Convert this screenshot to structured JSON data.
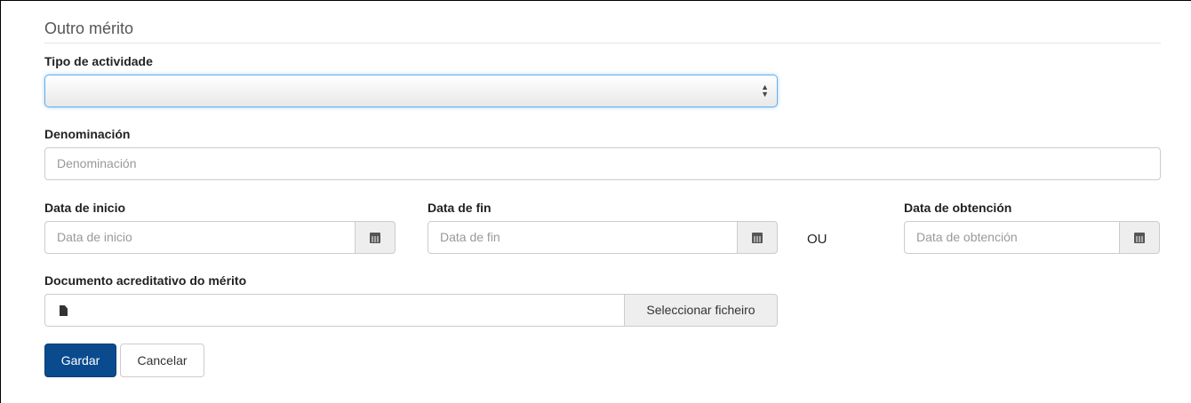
{
  "form": {
    "legend": "Outro mérito",
    "tipo": {
      "label": "Tipo de actividade",
      "value": ""
    },
    "denominacion": {
      "label": "Denominación",
      "placeholder": "Denominación"
    },
    "data_inicio": {
      "label": "Data de inicio",
      "placeholder": "Data de inicio",
      "icon": "calendar-icon"
    },
    "data_fin": {
      "label": "Data de fin",
      "placeholder": "Data de fin",
      "icon": "calendar-icon"
    },
    "ou": "OU",
    "data_obtencion": {
      "label": "Data de obtención",
      "placeholder": "Data de obtención",
      "icon": "calendar-icon"
    },
    "documento": {
      "label": "Documento acreditativo do mérito",
      "button": "Seleccionar ficheiro",
      "icon": "file-icon"
    },
    "actions": {
      "save": "Gardar",
      "cancel": "Cancelar"
    }
  },
  "colors": {
    "primary": "#0a4b8e",
    "focus": "#66afe9"
  }
}
